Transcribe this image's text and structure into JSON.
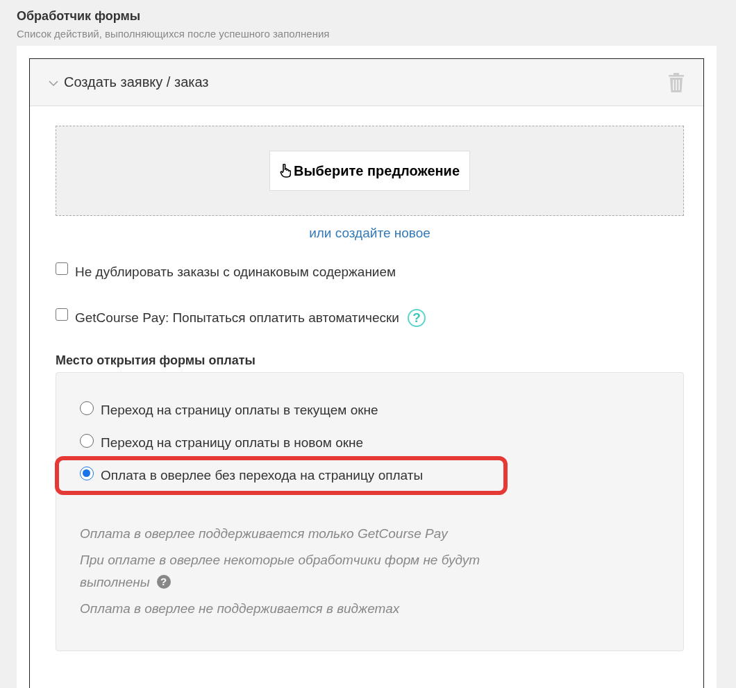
{
  "header": {
    "title": "Обработчик формы",
    "subtitle": "Список действий, выполняющихся после успешного заполнения"
  },
  "action": {
    "title": "Создать заявку / заказ",
    "expanded": true,
    "offer_button": "Выберите предложение",
    "create_link": "или создайте новое",
    "checkboxes": [
      {
        "label": "Не дублировать заказы с одинаковым содержанием",
        "checked": false
      },
      {
        "label": "GetCourse Pay: Попытаться оплатить автоматически",
        "checked": false,
        "help": "?"
      }
    ],
    "payment_section": {
      "title": "Место открытия формы оплаты",
      "options": [
        {
          "label": "Переход на страницу оплаты в текущем окне",
          "selected": false,
          "highlighted": false
        },
        {
          "label": "Переход на страницу оплаты в новом окне",
          "selected": false,
          "highlighted": false
        },
        {
          "label": "Оплата в оверлее без перехода на страницу оплаты",
          "selected": true,
          "highlighted": true
        }
      ],
      "notes": [
        {
          "text": "Оплата в оверлее поддерживается только GetCourse Pay"
        },
        {
          "text": "При оплате в оверлее некоторые обработчики форм не будут выполнены",
          "help": "?"
        },
        {
          "text": "Оплата в оверлее не поддерживается в виджетах"
        }
      ]
    }
  }
}
